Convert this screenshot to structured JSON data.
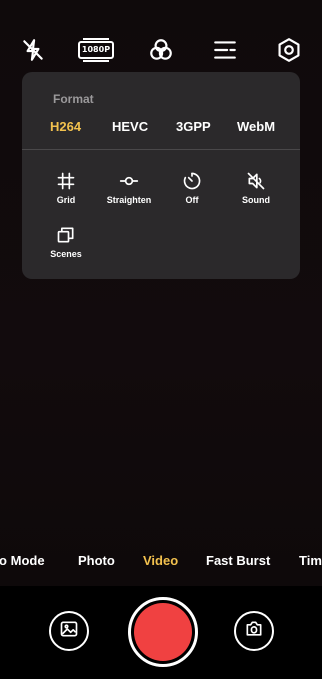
{
  "topbar": {
    "flash_icon": "flash-off-icon",
    "resolution_label": "1080P",
    "filters_icon": "filters-icon",
    "menu_icon": "menu-icon",
    "settings_icon": "gear-icon"
  },
  "panel": {
    "title": "Format",
    "formats": [
      {
        "label": "H264",
        "active": true
      },
      {
        "label": "HEVC",
        "active": false
      },
      {
        "label": "3GPP",
        "active": false
      },
      {
        "label": "WebM",
        "active": false
      }
    ],
    "options": [
      {
        "label": "Grid",
        "icon": "grid-icon"
      },
      {
        "label": "Straighten",
        "icon": "straighten-icon"
      },
      {
        "label": "Off",
        "icon": "timer-icon"
      },
      {
        "label": "Sound",
        "icon": "sound-off-icon"
      },
      {
        "label": "Scenes",
        "icon": "scenes-icon"
      }
    ]
  },
  "modes": [
    {
      "label": "ro Mode",
      "active": false
    },
    {
      "label": "Photo",
      "active": false
    },
    {
      "label": "Video",
      "active": true
    },
    {
      "label": "Fast Burst",
      "active": false
    },
    {
      "label": "Tim",
      "active": false
    }
  ],
  "bottom": {
    "gallery_icon": "gallery-icon",
    "shutter_color": "#f04141",
    "flip_icon": "flip-camera-icon"
  },
  "colors": {
    "accent": "#f2c14e",
    "panel_bg": "#2b292b"
  }
}
